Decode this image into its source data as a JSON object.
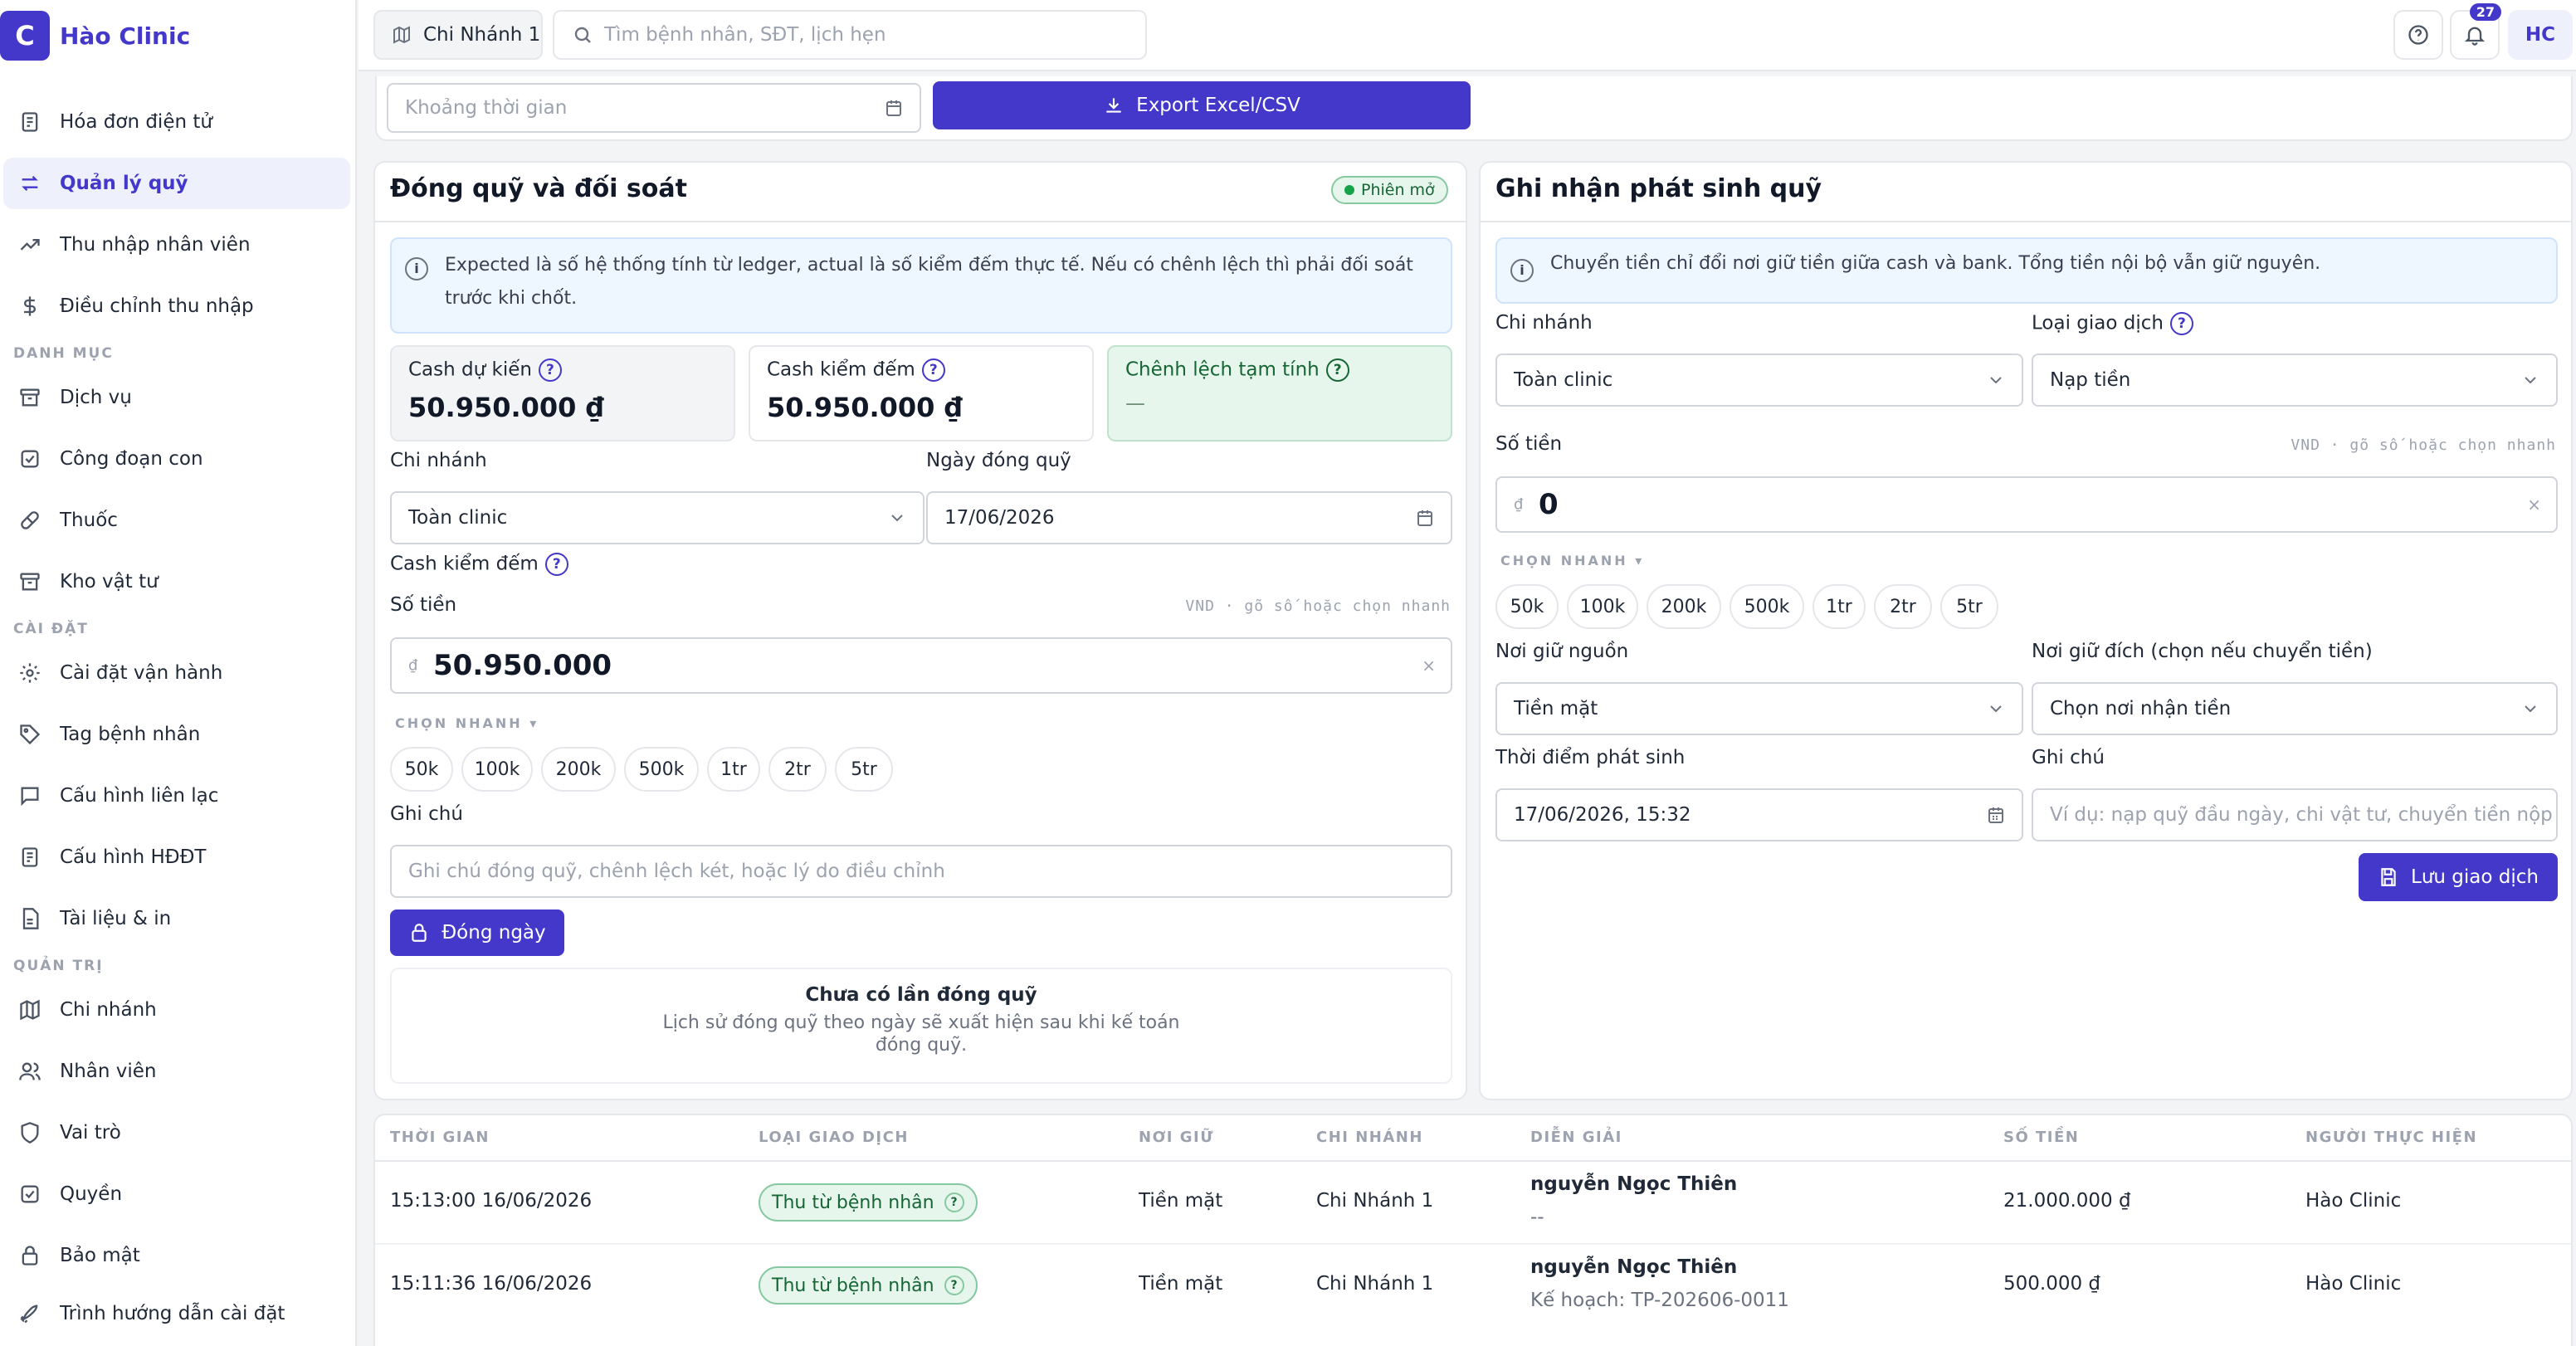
{
  "brand": {
    "logo_letter": "C",
    "name": "Hào Clinic"
  },
  "sidebar": {
    "items": [
      {
        "label": "Hóa đơn điện tử",
        "icon": "receipt-icon"
      },
      {
        "label": "Quản lý quỹ",
        "icon": "transfer-icon"
      },
      {
        "label": "Thu nhập nhân viên",
        "icon": "trend-up-icon"
      },
      {
        "label": "Điều chỉnh thu nhập",
        "icon": "dollar-icon"
      }
    ],
    "section_catalog": "DANH MỤC",
    "catalog_items": [
      {
        "label": "Dịch vụ",
        "icon": "archive-icon"
      },
      {
        "label": "Công đoạn con",
        "icon": "checkbox-icon"
      },
      {
        "label": "Thuốc",
        "icon": "pill-icon"
      },
      {
        "label": "Kho vật tư",
        "icon": "archive-icon"
      }
    ],
    "section_settings": "CÀI ĐẶT",
    "settings_items": [
      {
        "label": "Cài đặt vận hành",
        "icon": "gear-icon"
      },
      {
        "label": "Tag bệnh nhân",
        "icon": "tag-icon"
      },
      {
        "label": "Cấu hình liên lạc",
        "icon": "chat-icon"
      },
      {
        "label": "Cấu hình HĐĐT",
        "icon": "receipt-icon"
      },
      {
        "label": "Tài liệu & in",
        "icon": "document-icon"
      }
    ],
    "section_admin": "QUẢN TRỊ",
    "admin_items": [
      {
        "label": "Chi nhánh",
        "icon": "map-icon"
      },
      {
        "label": "Nhân viên",
        "icon": "users-icon"
      },
      {
        "label": "Vai trò",
        "icon": "shield-icon"
      },
      {
        "label": "Quyền",
        "icon": "checkbox-icon"
      },
      {
        "label": "Bảo mật",
        "icon": "lock-icon"
      },
      {
        "label": "Trình hướng dẫn cài đặt",
        "icon": "rocket-icon"
      }
    ]
  },
  "topbar": {
    "branch": "Chi Nhánh 1",
    "search_placeholder": "Tìm bệnh nhân, SĐT, lịch hẹn",
    "notifications_count": "27",
    "avatar_initials": "HC"
  },
  "filter": {
    "period_placeholder": "Khoảng thời gian",
    "export_label": "Export Excel/CSV"
  },
  "close_panel": {
    "title": "Đóng quỹ và đối soát",
    "status": "Phiên mở",
    "info_line1": "Expected là số hệ thống tính từ ledger, actual là số kiểm đếm thực tế. Nếu có chênh lệch thì phải đối soát",
    "info_line2": "trước khi chốt.",
    "stat_expected_label": "Cash dự kiến",
    "stat_expected_value": "50.950.000 ₫",
    "stat_counted_label": "Cash kiểm đếm",
    "stat_counted_value": "50.950.000 ₫",
    "stat_diff_label": "Chênh lệch tạm tính",
    "stat_diff_value": "—",
    "branch_label": "Chi nhánh",
    "branch_value": "Toàn clinic",
    "date_label": "Ngày đóng quỹ",
    "date_value": "17/06/2026",
    "cash_counted_label": "Cash kiểm đếm",
    "amount_label": "Số tiền",
    "amount_hint": "VND · gõ số hoặc chọn nhanh",
    "currency_symbol": "₫",
    "amount_value": "50.950.000",
    "clear": "×",
    "quick_title": "CHỌN NHANH ▾",
    "quick": [
      "50k",
      "100k",
      "200k",
      "500k",
      "1tr",
      "2tr",
      "5tr"
    ],
    "note_label": "Ghi chú",
    "note_placeholder": "Ghi chú đóng quỹ, chênh lệch két, hoặc lý do điều chỉnh",
    "close_button": "Đóng ngày",
    "empty_title": "Chưa có lần đóng quỹ",
    "empty_line1": "Lịch sử đóng quỹ theo ngày sẽ xuất hiện sau khi kế toán",
    "empty_line2": "đóng quỹ."
  },
  "record_panel": {
    "title": "Ghi nhận phát sinh quỹ",
    "info": "Chuyển tiền chỉ đổi nơi giữ tiền giữa cash và bank. Tổng tiền nội bộ vẫn giữ nguyên.",
    "branch_label": "Chi nhánh",
    "branch_value": "Toàn clinic",
    "type_label": "Loại giao dịch",
    "type_value": "Nạp tiền",
    "amount_label": "Số tiền",
    "amount_hint": "VND · gõ số hoặc chọn nhanh",
    "currency_symbol": "₫",
    "amount_value": "0",
    "clear": "×",
    "quick_title": "CHỌN NHANH ▾",
    "quick": [
      "50k",
      "100k",
      "200k",
      "500k",
      "1tr",
      "2tr",
      "5tr"
    ],
    "source_label": "Nơi giữ nguồn",
    "source_value": "Tiền mặt",
    "dest_label": "Nơi giữ đích (chọn nếu chuyển tiền)",
    "dest_value": "Chọn nơi nhận tiền",
    "time_label": "Thời điểm phát sinh",
    "time_value": "17/06/2026, 15:32",
    "note_label": "Ghi chú",
    "note_placeholder": "Ví dụ: nạp quỹ đầu ngày, chi vật tư, chuyển tiền nộp ng",
    "save_button": "Lưu giao dịch"
  },
  "table": {
    "headers": [
      "THỜI GIAN",
      "LOẠI GIAO DỊCH",
      "NƠI GIỮ",
      "CHI NHÁNH",
      "DIỄN GIẢI",
      "SỐ TIỀN",
      "NGƯỜI THỰC HIỆN"
    ],
    "rows": [
      {
        "time": "15:13:00 16/06/2026",
        "type": "Thu từ bệnh nhân",
        "holder": "Tiền mặt",
        "branch": "Chi Nhánh 1",
        "desc_main": "nguyễn Ngọc Thiên",
        "desc_sub": "--",
        "amount": "21.000.000 ₫",
        "actor": "Hào Clinic"
      },
      {
        "time": "15:11:36 16/06/2026",
        "type": "Thu từ bệnh nhân",
        "holder": "Tiền mặt",
        "branch": "Chi Nhánh 1",
        "desc_main": "nguyễn Ngọc Thiên",
        "desc_sub": "Kế hoạch: TP-202606-0011",
        "amount": "500.000 ₫",
        "actor": "Hào Clinic"
      }
    ]
  },
  "colors": {
    "accent": "#4338ca",
    "success_bg": "#e7f6ec",
    "info_bg": "#eef6ff"
  }
}
